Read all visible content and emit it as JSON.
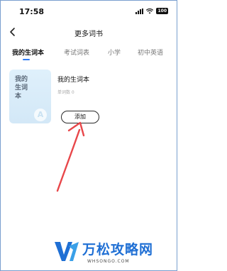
{
  "status_bar": {
    "time": "17:58",
    "battery": "100",
    "icons": [
      "signal-icon",
      "wifi-icon",
      "battery-icon"
    ]
  },
  "nav": {
    "title": "更多词书",
    "back_icon": "chevron-left-icon"
  },
  "tabs": [
    {
      "label": "我的生词本",
      "active": true
    },
    {
      "label": "考试词表",
      "active": false
    },
    {
      "label": "小学",
      "active": false
    },
    {
      "label": "初中英语",
      "active": false
    }
  ],
  "book": {
    "cover_title": "我的生词本",
    "cover_letter": "A",
    "name": "我的生词本",
    "word_count": "单词数 0",
    "add_label": "添加"
  },
  "annotation": {
    "arrow_color": "#e8474a"
  },
  "watermark": {
    "brand": "万松攻略网",
    "url": "WHSONGO.COM",
    "colors": [
      "#1f6fd4",
      "#4a4a4a"
    ]
  }
}
